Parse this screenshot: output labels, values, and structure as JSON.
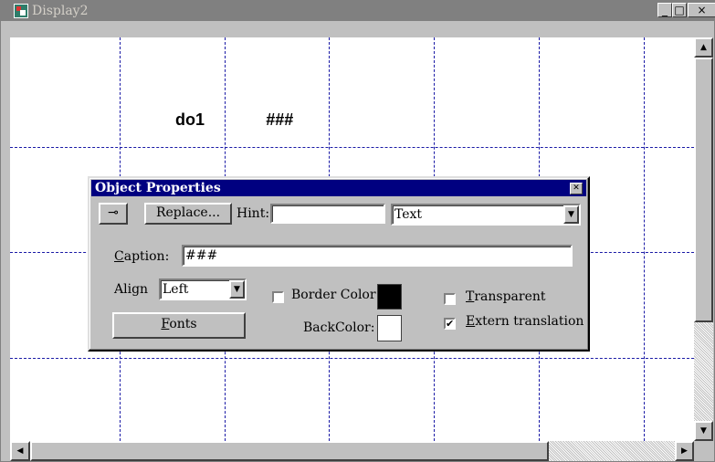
{
  "window": {
    "title": "Display2",
    "min_glyph": "_",
    "max_glyph": "□",
    "close_glyph": "×",
    "icon": "display-app-icon"
  },
  "canvas": {
    "labels": [
      {
        "text": "do1"
      },
      {
        "text": "###"
      }
    ]
  },
  "dialog": {
    "title": "Object Properties",
    "close_glyph": "✕",
    "pin_icon": "pin-icon",
    "pin_glyph": "⊸",
    "replace_label": "Replace...",
    "hint_label": "Hint:",
    "hint_value": "",
    "type_value": "Text",
    "caption_label": "Caption:",
    "caption_value": "###",
    "align_label": "Align",
    "align_value": "Left",
    "fonts_label": "Fonts",
    "border_color_label": "Border Color",
    "border_color_checked": false,
    "border_color": "#000000",
    "back_color_label": "BackColor:",
    "back_color": "#ffffff",
    "transparent_label": "Transparent",
    "transparent_checked": false,
    "extern_translation_label": "Extern translation",
    "extern_translation_checked": true,
    "check_glyph": "✔"
  },
  "scrollbars": {
    "up_glyph": "▲",
    "down_glyph": "▼",
    "left_glyph": "◀",
    "right_glyph": "▶",
    "dropdown_glyph": "▼"
  },
  "colors": {
    "grid_line": "#1a1aa6",
    "dialog_title_bg": "#000080",
    "window_title_bg": "#808080"
  }
}
